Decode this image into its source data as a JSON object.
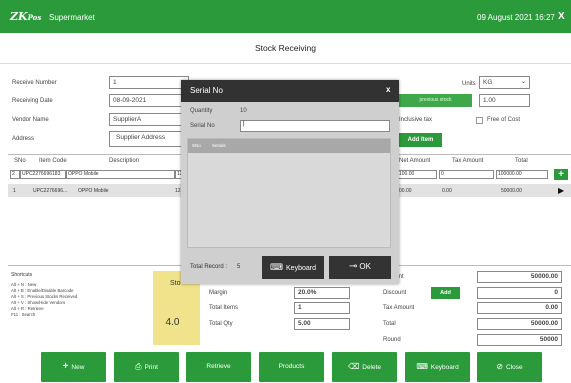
{
  "app": {
    "logo": "ZK",
    "logo_suffix": "Pos",
    "title": "Supermarket",
    "datetime": "09 August 2021 16:27",
    "close": "X"
  },
  "page_title": "Stock Receiving",
  "form": {
    "receive_number_label": "Receive Number",
    "receive_number": "1",
    "receiving_date_label": "Receiving Date",
    "receiving_date": "08-09-2021",
    "vendor_name_label": "Vendor Name",
    "vendor_name": "SupplierA",
    "address_label": "Address",
    "address": "Supplier Address",
    "units_label": "Units",
    "units_value": "KG",
    "previous_stock_button": "previous stock",
    "previous_stock_value": "1.00",
    "inclusive_tax_label": "Inclusive tax",
    "free_of_cost_label": "Free of Cost",
    "add_item_button": "Add Item"
  },
  "table": {
    "headers": [
      "SNo",
      "Item Code",
      "Description",
      "Net Amount",
      "Tax Amount",
      "Total"
    ],
    "entry_row": {
      "sno": "2",
      "code": "UPC2276696183",
      "desc": "OPPO Mobile",
      "qty": "120",
      "net": "100.00",
      "tax": "0",
      "total": "100000.00"
    },
    "rows": [
      {
        "sno": "1",
        "code": "UPC2276696...",
        "desc": "OPPO Mobile",
        "qty": "12",
        "net": "00.00",
        "tax": "0.00",
        "total": "50000.00"
      }
    ]
  },
  "shortcuts": {
    "title": "Shortcuts",
    "lines": [
      "Alt + N : New",
      "Alt + B : Enable/Disable Barcode",
      "Alt + S : Previous Stocks Received",
      "Alt + V : Show/Hide Vendors",
      "Alt + R : Retrieve",
      "F11 : Search"
    ]
  },
  "stock_panel": {
    "label": "Sto",
    "value": "4.0"
  },
  "summary_mid": {
    "margin_label": "Margin",
    "margin_value": "20.0%",
    "total_items_label": "Total Items",
    "total_items_value": "1",
    "total_qty_label": "Total Qty",
    "total_qty_value": "5.00"
  },
  "summary_right": {
    "amount_label": "Amount",
    "amount_value": "50000.00",
    "discount_label": "Discount",
    "discount_button": "Add",
    "discount_value": "0",
    "tax_amount_label": "Tax Amount",
    "tax_amount_value": "0.00",
    "total_label": "Total",
    "total_value": "50000.00",
    "round_label": "Round",
    "round_value": "50000"
  },
  "bottom_buttons": [
    {
      "icon": "+",
      "label": "New"
    },
    {
      "icon": "⎙",
      "label": "Print"
    },
    {
      "icon": "",
      "label": "Retrieve"
    },
    {
      "icon": "",
      "label": "Products"
    },
    {
      "icon": "⌫",
      "label": "Delete"
    },
    {
      "icon": "⌨",
      "label": "Keyboard"
    },
    {
      "icon": "⊘",
      "label": "Close"
    }
  ],
  "modal": {
    "title": "Serial No",
    "close": "x",
    "quantity_label": "Quantity",
    "quantity_value": "10",
    "serial_label": "Serial No",
    "serial_value": "",
    "col_sno": "SNo",
    "col_serials": "Serials",
    "total_record_label": "Total Record :",
    "total_record_value": "5",
    "keyboard_button": "Keyboard",
    "ok_button": "OK"
  },
  "colors": {
    "brand_green": "#2b9a3a",
    "modal_header": "#323232",
    "modal_body": "#cfcfcf",
    "stock_panel": "#f1e38c"
  }
}
